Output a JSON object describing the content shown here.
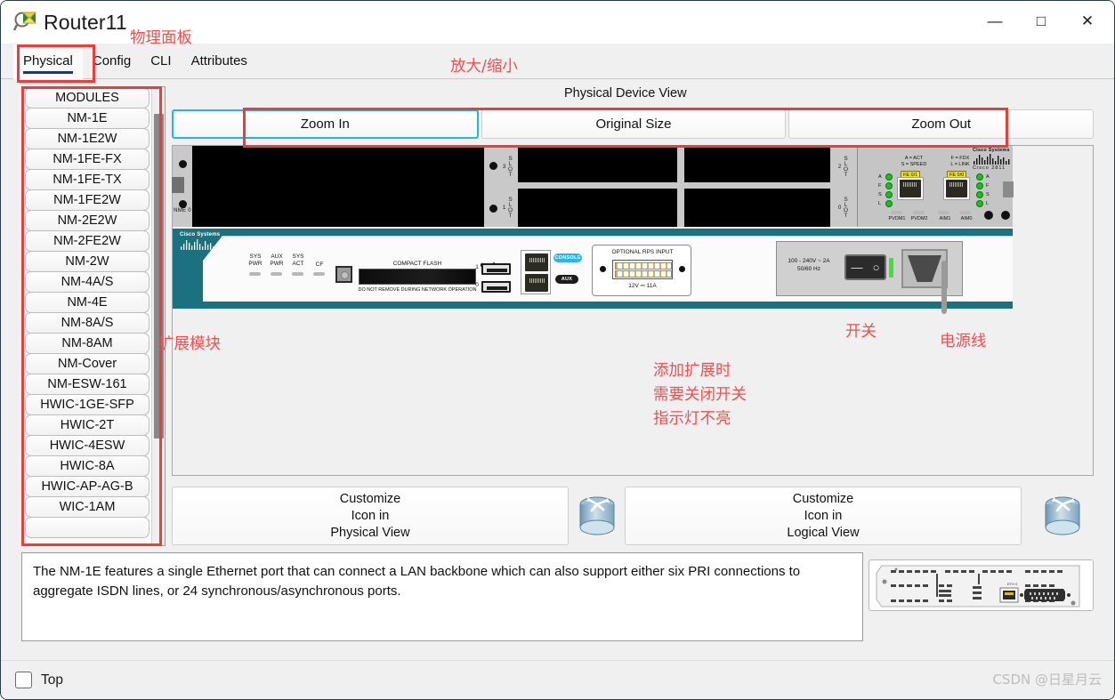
{
  "window": {
    "title": "Router11",
    "icon": "router-magnifier-icon",
    "minimize": "—",
    "maximize": "□",
    "close": "✕"
  },
  "tabs": [
    {
      "label": "Physical",
      "active": true
    },
    {
      "label": "Config",
      "active": false
    },
    {
      "label": "CLI",
      "active": false
    },
    {
      "label": "Attributes",
      "active": false
    }
  ],
  "modules": {
    "header": "MODULES",
    "items": [
      "NM-1E",
      "NM-1E2W",
      "NM-1FE-FX",
      "NM-1FE-TX",
      "NM-1FE2W",
      "NM-2E2W",
      "NM-2FE2W",
      "NM-2W",
      "NM-4A/S",
      "NM-4E",
      "NM-8A/S",
      "NM-8AM",
      "NM-Cover",
      "NM-ESW-161",
      "HWIC-1GE-SFP",
      "HWIC-2T",
      "HWIC-4ESW",
      "HWIC-8A",
      "HWIC-AP-AG-B",
      "WIC-1AM"
    ]
  },
  "device_view": {
    "title": "Physical Device View",
    "zoom_buttons": [
      "Zoom In",
      "Original Size",
      "Zoom Out"
    ]
  },
  "device": {
    "rear": {
      "nme_label": "NME 0",
      "slot_labels": [
        "SLOT 3",
        "SLOT 1",
        "SLOT 2",
        "SLOT 0"
      ],
      "led_legend_left": "A = ACT\nS = SPEED",
      "led_legend_right": "F = FDX\nL = LINK",
      "port_tags": [
        "FE 0/1",
        "FE 0/0"
      ],
      "led_letters_left": [
        "A",
        "F",
        "S",
        "L"
      ],
      "led_letters_right": [
        "A",
        "F",
        "S",
        "L"
      ],
      "small_labels": [
        "PVDM1",
        "PVDM2",
        "AIM1",
        "AIM0"
      ],
      "brand": "Cisco Systems",
      "model": "Cisco 2811"
    },
    "front": {
      "brand": "Cisco Systems",
      "led_labels": [
        "SYS\nPWR",
        "AUX\nPWR",
        "SYS\nACT",
        "CF"
      ],
      "compact_flash": "COMPACT FLASH",
      "compact_flash_warning": "DO NOT REMOVE DURING NETWORK OPERATION",
      "usb_numbers": [
        "1",
        "0"
      ],
      "console_label": "CONSOLE",
      "aux_label": "AUX",
      "rps_title": "OPTIONAL RPS INPUT",
      "rps_rating": "12V  ⎓  11A",
      "psu_rating": "100 - 240V ~ 2A\n50/60 Hz",
      "switch_off": "—",
      "switch_on": "○"
    }
  },
  "annotations": {
    "physical_panel": "物理面板",
    "zoom_inout": "放大/缩小",
    "expansion_module": "扩展模块",
    "switch": "开关",
    "power_cord": "电源线",
    "note_line1": "添加扩展时",
    "note_line2": "需要关闭开关",
    "note_line3": "指示灯不亮",
    "color": "#f05050"
  },
  "customize": {
    "physical": {
      "line1": "Customize",
      "line2": "Icon in",
      "line3": "Physical View"
    },
    "logical": {
      "line1": "Customize",
      "line2": "Icon in",
      "line3": "Logical View"
    }
  },
  "description": "The NM-1E features a single Ethernet port that can connect a LAN backbone which can also support either six PRI connections to aggregate ISDN lines, or 24 synchronous/asynchronous ports.",
  "module_preview": {
    "port_label": "ETH 0"
  },
  "statusbar": {
    "top_label": "Top",
    "checked": false
  },
  "watermark": "CSDN @日星月云"
}
